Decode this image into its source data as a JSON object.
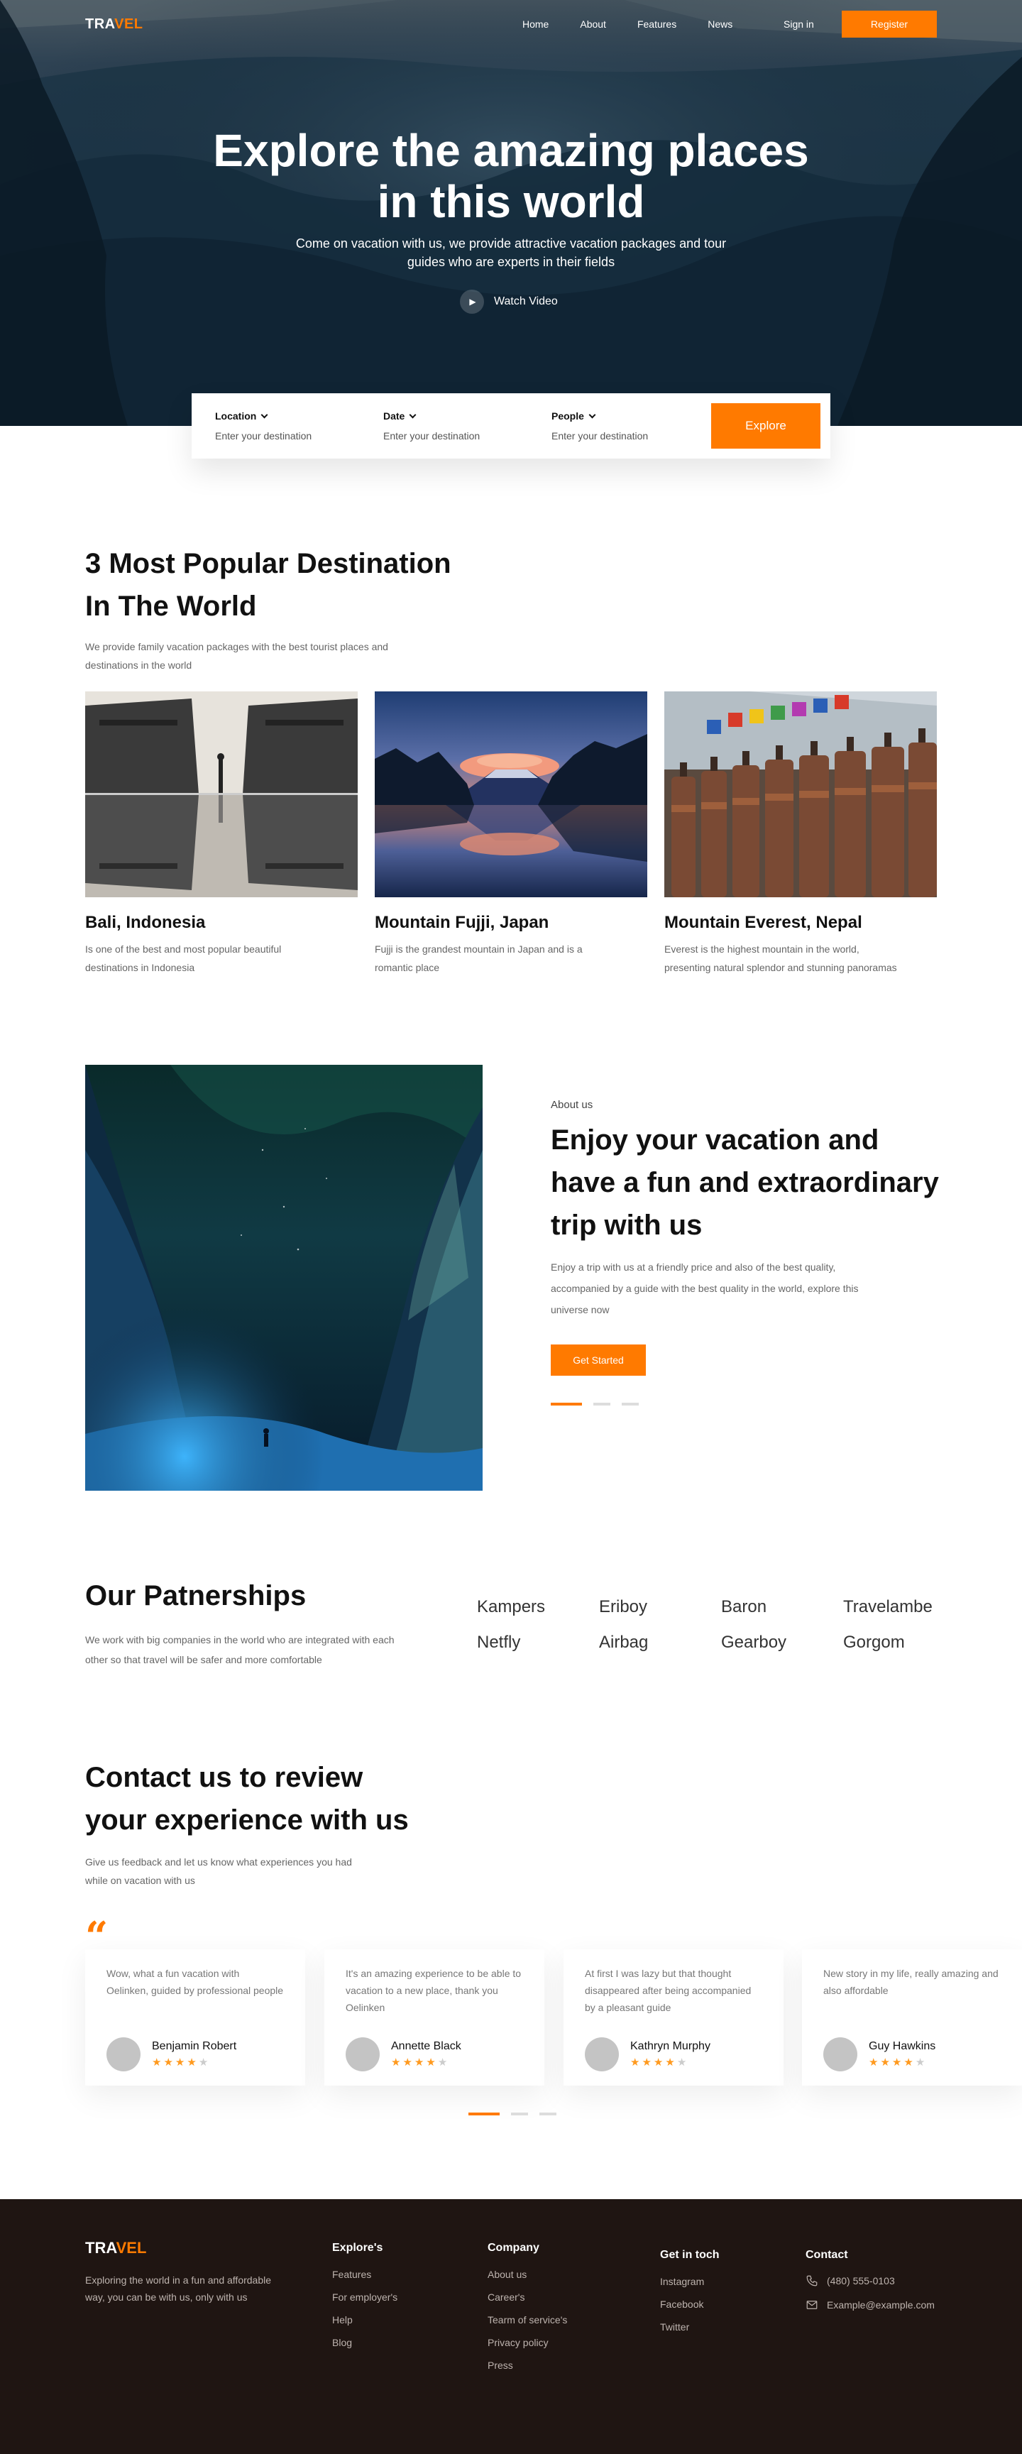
{
  "brand": {
    "logo_main": "TRA",
    "logo_accent": "VEL",
    "accent_color": "#ff7a00"
  },
  "nav": {
    "links": [
      "Home",
      "About",
      "Features",
      "News"
    ],
    "signin": "Sign in",
    "register": "Register"
  },
  "hero": {
    "title_line1": "Explore the amazing places",
    "title_line2": "in this world",
    "subtitle": "Come on vacation with us, we provide attractive vacation packages and tour guides who are experts in their fields",
    "watch_label": "Watch Video"
  },
  "search": {
    "location_label": "Location",
    "date_label": "Date",
    "people_label": "People",
    "placeholder": "Enter your destination",
    "button": "Explore"
  },
  "popular": {
    "title_line1": "3 Most Popular Destination",
    "title_line2": "In The World",
    "description": "We provide family vacation packages with the best tourist places and destinations in the world",
    "cards": [
      {
        "name": "Bali, Indonesia",
        "desc": "Is one of the best and most popular beautiful destinations in Indonesia"
      },
      {
        "name": "Mountain Fujji, Japan",
        "desc": "Fujji is the grandest mountain in Japan and is a romantic place"
      },
      {
        "name": "Mountain Everest, Nepal",
        "desc": "Everest is the highest mountain in the world, presenting natural splendor and stunning panoramas"
      }
    ]
  },
  "about": {
    "kicker": "About us",
    "title": "Enjoy your vacation and have a fun and extraordinary trip with us",
    "description": "Enjoy a trip with us at a friendly price and also of the best quality, accompanied by a guide with the best quality in the world, explore this universe now",
    "button": "Get Started"
  },
  "partners": {
    "title": "Our Patnerships",
    "description": "We work with big companies in the world who are integrated with each other so that travel will be safer and more comfortable",
    "names": [
      "Kampers",
      "Eriboy",
      "Baron",
      "Travelambe",
      "Netfly",
      "Airbag",
      "Gearboy",
      "Gorgom"
    ]
  },
  "reviews": {
    "title_line1": "Contact us to review",
    "title_line2": "your experience with us",
    "description": "Give us feedback and let us know what experiences you had while on vacation with us",
    "quote_mark": "“",
    "items": [
      {
        "text": "Wow, what a fun vacation with Oelinken, guided by professional people",
        "name": "Benjamin Robert",
        "rating": 4
      },
      {
        "text": "It's an amazing experience to be able to vacation to a new place, thank you Oelinken",
        "name": "Annette Black",
        "rating": 4
      },
      {
        "text": "At first I was lazy but that thought disappeared after being accompanied by a pleasant guide",
        "name": "Kathryn Murphy",
        "rating": 4
      },
      {
        "text": "New story in my life, really amazing and also affordable",
        "name": "Guy Hawkins",
        "rating": 4
      }
    ]
  },
  "footer": {
    "description": "Exploring the world in a fun and affordable way, you can be with us, only with us",
    "explore": {
      "heading": "Explore's",
      "links": [
        "Features",
        "For employer's",
        "Help",
        "Blog"
      ]
    },
    "company": {
      "heading": "Company",
      "links": [
        "About us",
        "Career's",
        "Tearm of service's",
        "Privacy policy",
        "Press"
      ]
    },
    "social": {
      "heading": "Get in toch",
      "links": [
        "Instagram",
        "Facebook",
        "Twitter"
      ]
    },
    "contact": {
      "heading": "Contact",
      "phone": "(480) 555-0103",
      "email": "Example@example.com"
    }
  }
}
